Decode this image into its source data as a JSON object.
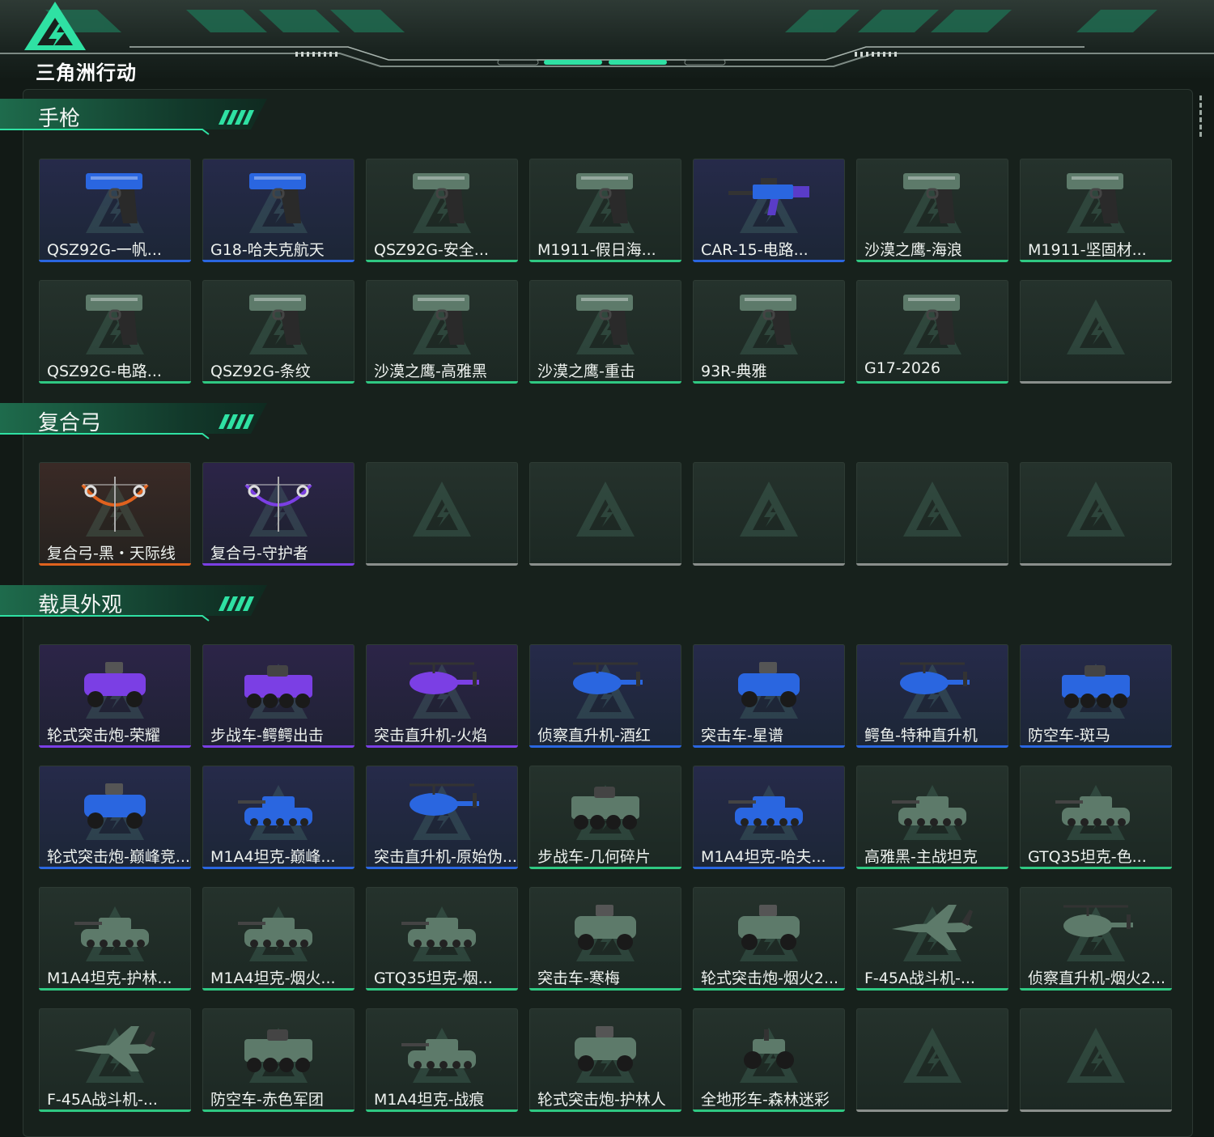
{
  "app": {
    "logo_text": "三角洲行动"
  },
  "colors": {
    "accent": "#2fe1a3",
    "rarity_green": "#2fc882",
    "rarity_blue": "#2a66e0",
    "rarity_purple": "#7b3fe4",
    "rarity_orange": "#e0621e",
    "empty": "#8a8f8c"
  },
  "sections": [
    {
      "title": "手枪",
      "items": [
        {
          "label": "QSZ92G-一帆...",
          "rarity": "blue",
          "icon": "pistol-icon"
        },
        {
          "label": "G18-哈夫克航天",
          "rarity": "blue",
          "icon": "pistol-icon"
        },
        {
          "label": "QSZ92G-安全...",
          "rarity": "green",
          "icon": "pistol-icon"
        },
        {
          "label": "M1911-假日海...",
          "rarity": "green",
          "icon": "pistol-icon"
        },
        {
          "label": "CAR-15-电路...",
          "rarity": "blue",
          "icon": "rifle-icon"
        },
        {
          "label": "沙漠之鹰-海浪",
          "rarity": "green",
          "icon": "pistol-icon"
        },
        {
          "label": "M1911-坚固材...",
          "rarity": "green",
          "icon": "pistol-icon"
        },
        {
          "label": "QSZ92G-电路...",
          "rarity": "green",
          "icon": "pistol-icon"
        },
        {
          "label": "QSZ92G-条纹",
          "rarity": "green",
          "icon": "pistol-icon"
        },
        {
          "label": "沙漠之鹰-高雅黑",
          "rarity": "green",
          "icon": "pistol-icon"
        },
        {
          "label": "沙漠之鹰-重击",
          "rarity": "green",
          "icon": "pistol-icon"
        },
        {
          "label": "93R-典雅",
          "rarity": "green",
          "icon": "pistol-icon"
        },
        {
          "label": "G17-2026",
          "rarity": "green",
          "icon": "pistol-icon"
        },
        {
          "label": "",
          "rarity": "empty",
          "icon": "empty-slot-icon"
        }
      ]
    },
    {
      "title": "复合弓",
      "items": [
        {
          "label": "复合弓-黑・天际线",
          "rarity": "orange",
          "icon": "bow-icon"
        },
        {
          "label": "复合弓-守护者",
          "rarity": "purple",
          "icon": "bow-icon"
        },
        {
          "label": "",
          "rarity": "empty",
          "icon": "empty-slot-icon"
        },
        {
          "label": "",
          "rarity": "empty",
          "icon": "empty-slot-icon"
        },
        {
          "label": "",
          "rarity": "empty",
          "icon": "empty-slot-icon"
        },
        {
          "label": "",
          "rarity": "empty",
          "icon": "empty-slot-icon"
        },
        {
          "label": "",
          "rarity": "empty",
          "icon": "empty-slot-icon"
        }
      ]
    },
    {
      "title": "载具外观",
      "items": [
        {
          "label": "轮式突击炮-荣耀",
          "rarity": "purple",
          "icon": "armored-car-icon"
        },
        {
          "label": "步战车-鳄鳄出击",
          "rarity": "purple",
          "icon": "ifv-icon"
        },
        {
          "label": "突击直升机-火焰",
          "rarity": "purple",
          "icon": "helicopter-icon"
        },
        {
          "label": "侦察直升机-酒红",
          "rarity": "blue",
          "icon": "helicopter-icon"
        },
        {
          "label": "突击车-星谱",
          "rarity": "blue",
          "icon": "armored-car-icon"
        },
        {
          "label": "鳄鱼-特种直升机",
          "rarity": "blue",
          "icon": "helicopter-icon"
        },
        {
          "label": "防空车-斑马",
          "rarity": "blue",
          "icon": "ifv-icon"
        },
        {
          "label": "轮式突击炮-巅峰竞...",
          "rarity": "blue",
          "icon": "armored-car-icon"
        },
        {
          "label": "M1A4坦克-巅峰...",
          "rarity": "blue",
          "icon": "tank-icon"
        },
        {
          "label": "突击直升机-原始伪...",
          "rarity": "blue",
          "icon": "helicopter-icon"
        },
        {
          "label": "步战车-几何碎片",
          "rarity": "green",
          "icon": "ifv-icon"
        },
        {
          "label": "M1A4坦克-哈夫...",
          "rarity": "blue",
          "icon": "tank-icon"
        },
        {
          "label": "高雅黑-主战坦克",
          "rarity": "green",
          "icon": "tank-icon"
        },
        {
          "label": "GTQ35坦克-色...",
          "rarity": "green",
          "icon": "tank-icon"
        },
        {
          "label": "M1A4坦克-护林...",
          "rarity": "green",
          "icon": "tank-icon"
        },
        {
          "label": "M1A4坦克-烟火...",
          "rarity": "green",
          "icon": "tank-icon"
        },
        {
          "label": "GTQ35坦克-烟...",
          "rarity": "green",
          "icon": "tank-icon"
        },
        {
          "label": "突击车-寒梅",
          "rarity": "green",
          "icon": "armored-car-icon"
        },
        {
          "label": "轮式突击炮-烟火2...",
          "rarity": "green",
          "icon": "armored-car-icon"
        },
        {
          "label": "F-45A战斗机-...",
          "rarity": "green",
          "icon": "jet-icon"
        },
        {
          "label": "侦察直升机-烟火2...",
          "rarity": "green",
          "icon": "helicopter-icon"
        },
        {
          "label": "F-45A战斗机-...",
          "rarity": "green",
          "icon": "jet-icon"
        },
        {
          "label": "防空车-赤色军团",
          "rarity": "green",
          "icon": "ifv-icon"
        },
        {
          "label": "M1A4坦克-战痕",
          "rarity": "green",
          "icon": "tank-icon"
        },
        {
          "label": "轮式突击炮-护林人",
          "rarity": "green",
          "icon": "armored-car-icon"
        },
        {
          "label": "全地形车-森林迷彩",
          "rarity": "green",
          "icon": "atv-icon"
        },
        {
          "label": "",
          "rarity": "empty",
          "icon": "empty-slot-icon"
        },
        {
          "label": "",
          "rarity": "empty",
          "icon": "empty-slot-icon"
        }
      ]
    }
  ]
}
